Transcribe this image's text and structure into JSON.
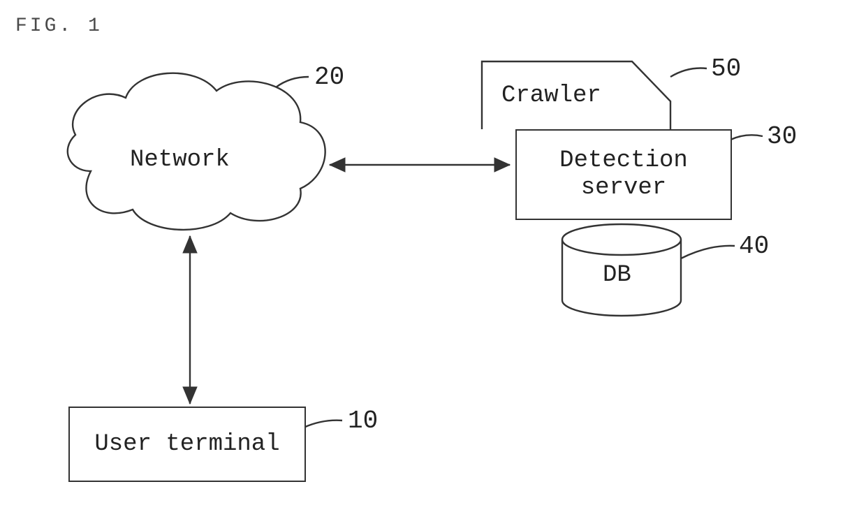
{
  "figure_title": "FIG. 1",
  "nodes": {
    "network": {
      "label": "Network",
      "ref": "20"
    },
    "crawler": {
      "label": "Crawler",
      "ref": "50"
    },
    "detection": {
      "label_l1": "Detection",
      "label_l2": "server",
      "ref": "30"
    },
    "db": {
      "label": "DB",
      "ref": "40"
    },
    "terminal": {
      "label": "User terminal",
      "ref": "10"
    }
  }
}
